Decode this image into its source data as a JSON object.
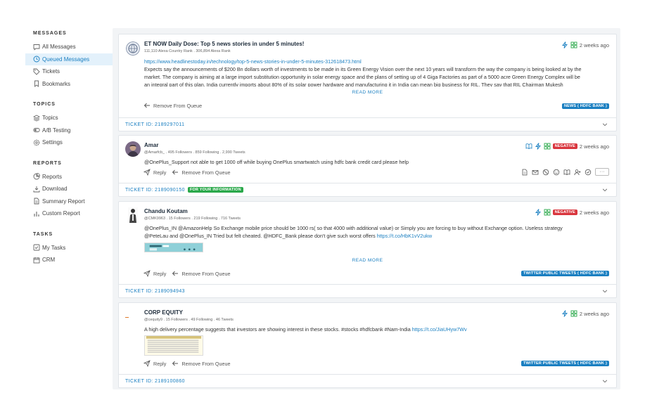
{
  "sidebar": {
    "messages_title": "MESSAGES",
    "messages_items": [
      "All Messages",
      "Queued Messages",
      "Tickets",
      "Bookmarks"
    ],
    "topics_title": "TOPICS",
    "topics_items": [
      "Topics",
      "A/B Testing",
      "Settings"
    ],
    "reports_title": "REPORTS",
    "reports_items": [
      "Reports",
      "Download",
      "Summary Report",
      "Custom Report"
    ],
    "tasks_title": "TASKS",
    "tasks_items": [
      "My Tasks",
      "CRM"
    ],
    "active_item": "Queued Messages",
    "accent": "#1a7fc1"
  },
  "cards": [
    {
      "title": "ET NOW Daily Dose: Top 5 news stories in under 5 minutes!",
      "meta": "111,110 Alexa Country Rank . 306,894 Alexa Rank",
      "url": "https://www.headlinestoday.in/technology/top-5-news-stories-in-under-5-minutes-312618473.html",
      "line1": "Expects say the announcements of $200 Bn dollars worth of investments to be made in its Green Energy Vision over the next 10 years will transform the way the company is being looked at by the",
      "line2": "market. The company is aiming at a large import substitution opportunity in solar energy space and the plans of setting up of 4 Giga Factories as part of a 5000 acre Green Energy Complex will be",
      "line3": "an integral part of this plan. India currently imports about 80% of its solar power hardware and manufacturing it in India can mean big business for RIL. They say that RIL Chairman Mukesh",
      "read_more": "READ MORE",
      "remove": "Remove From Queue",
      "tag": "NEWS ( HDFC BANK )",
      "time": "2 weeks ago",
      "ticket": "TICKET ID: 2189297011"
    },
    {
      "title": "Amar",
      "meta": "@Amarfcb_ . 495 Followers . 859 Following . 2,990 Tweets",
      "text": "@OnePlus_Support not able to get 1000 off while buying OnePlus smartwatch using hdfc bank credit card please help",
      "reply": "Reply",
      "remove": "Remove From Queue",
      "sentiment": "NEGATIVE",
      "time": "2 weeks ago",
      "ticket": "TICKET ID: 2189090150",
      "ticket_badge": "FOR YOUR INFORMATION"
    },
    {
      "title": "Chandu Koutam",
      "meta": "@CMK9963 . 15 Followers . 219 Following . 716 Tweets",
      "line1": "@OnePlus_IN @AmazonHelp So Exchange mobile price should be 1000 rs( so that 4000 with additional value) or Simply you are forcing to buy without Exchange option. Useless strategy",
      "line2a": "@PeteLau and @OnePlus_IN Tried but felt cheated. @HDFC_Bank please don't give such worst offers ",
      "line2b": "https://t.co/HbK1vV2ukw",
      "read_more": "READ MORE",
      "reply": "Reply",
      "remove": "Remove From Queue",
      "sentiment": "NEGATIVE",
      "tag": "TWITTER PUBLIC TWEETS ( HDFC BANK )",
      "time": "2 weeks ago",
      "ticket": "TICKET ID: 2189094943"
    },
    {
      "title": "CORP EQUITY",
      "meta": "@cequity9 . 15 Followers . 49 Following . 46 Tweets",
      "text_a": "A high delivery percentage suggests that investors are showing interest in these stocks. #stocks #hdfcbank #Nam-India ",
      "text_b": "https://t.co/JiaUHyw7Wv",
      "reply": "Reply",
      "remove": "Remove From Queue",
      "tag": "TWITTER PUBLIC TWEETS ( HDFC BANK )",
      "time": "2 weeks ago",
      "ticket": "TICKET ID: 2189100860"
    }
  ]
}
